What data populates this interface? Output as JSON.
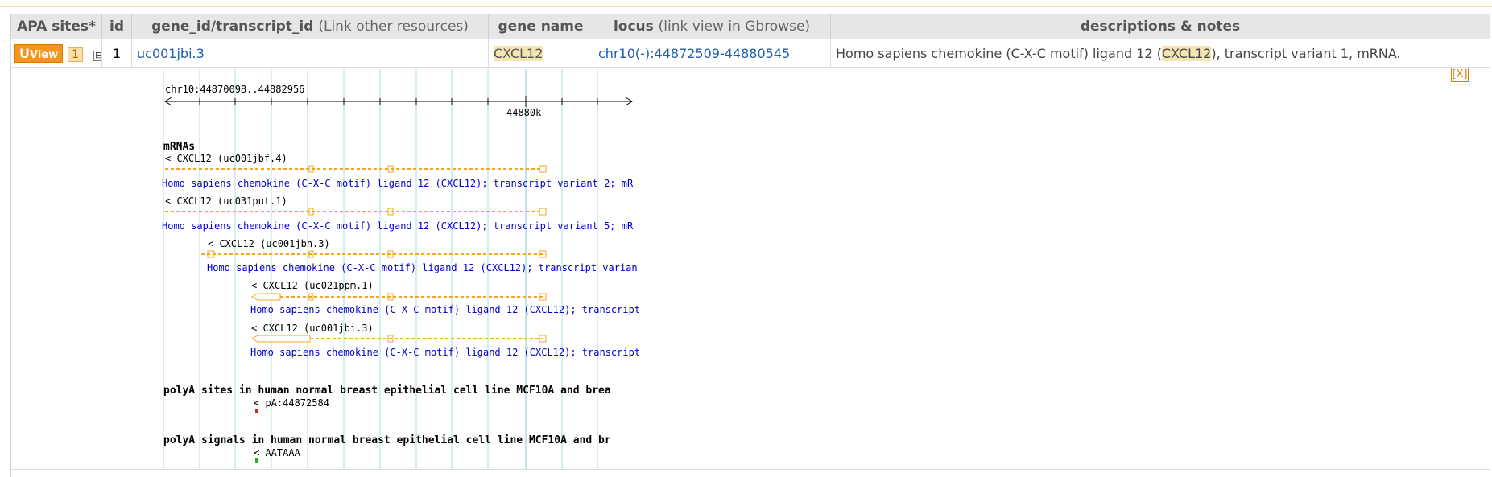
{
  "table": {
    "headers": {
      "apa": "APA sites*",
      "id": "id",
      "gene_main": "gene_id/transcript_id",
      "gene_sub": "(Link other resources)",
      "gene_name": "gene name",
      "locus_main": "locus",
      "locus_sub": "(link view in Gbrowse)",
      "desc": "descriptions & notes"
    },
    "row": {
      "uview_first": "U",
      "uview_rest": "View",
      "apa_count": "1",
      "expand_symbol": "⊟",
      "id": "1",
      "transcript_id": "uc001jbi.3",
      "gene_name": "CXCL12",
      "locus": "chr10(-):44872509-44880545",
      "desc_pre": "Homo sapiens chemokine (C-X-C motif) ligand 12 (",
      "desc_hl": "CXCL12",
      "desc_post": "), transcript variant 1, mRNA."
    }
  },
  "close_label": "[X]",
  "gbrowse": {
    "region": "chr10:44870098..44882956",
    "scale_label": "44880k",
    "mrna_track": "mRNAs",
    "transcripts": [
      {
        "label": "< CXCL12 (uc001jbf.4)",
        "desc": "Homo sapiens chemokine (C-X-C motif) ligand 12 (CXCL12); transcript variant 2; mR"
      },
      {
        "label": "< CXCL12 (uc031put.1)",
        "desc": "Homo sapiens chemokine (C-X-C motif) ligand 12 (CXCL12); transcript variant 5; mR"
      },
      {
        "label": "< CXCL12 (uc001jbh.3)",
        "desc": "Homo sapiens chemokine (C-X-C motif) ligand 12 (CXCL12); transcript varian"
      },
      {
        "label": "< CXCL12 (uc021ppm.1)",
        "desc": "Homo sapiens chemokine (C-X-C motif) ligand 12 (CXCL12); transcript"
      },
      {
        "label": "< CXCL12 (uc001jbi.3)",
        "desc": "Homo sapiens chemokine (C-X-C motif) ligand 12 (CXCL12); transcript"
      }
    ],
    "polya_sites_track": "polyA sites in human normal breast epithelial cell line MCF10A and brea",
    "polya_site_label": "< pA:44872584",
    "polya_signals_track": "polyA signals in human normal breast epithelial cell line MCF10A and br",
    "polya_signal_label": "< AATAAA",
    "colors": {
      "transcript": "#f5a623",
      "link_text": "#0000cc",
      "site_mark": "#e02020",
      "signal_mark": "#20b020",
      "grid": "#aadfe6"
    }
  }
}
